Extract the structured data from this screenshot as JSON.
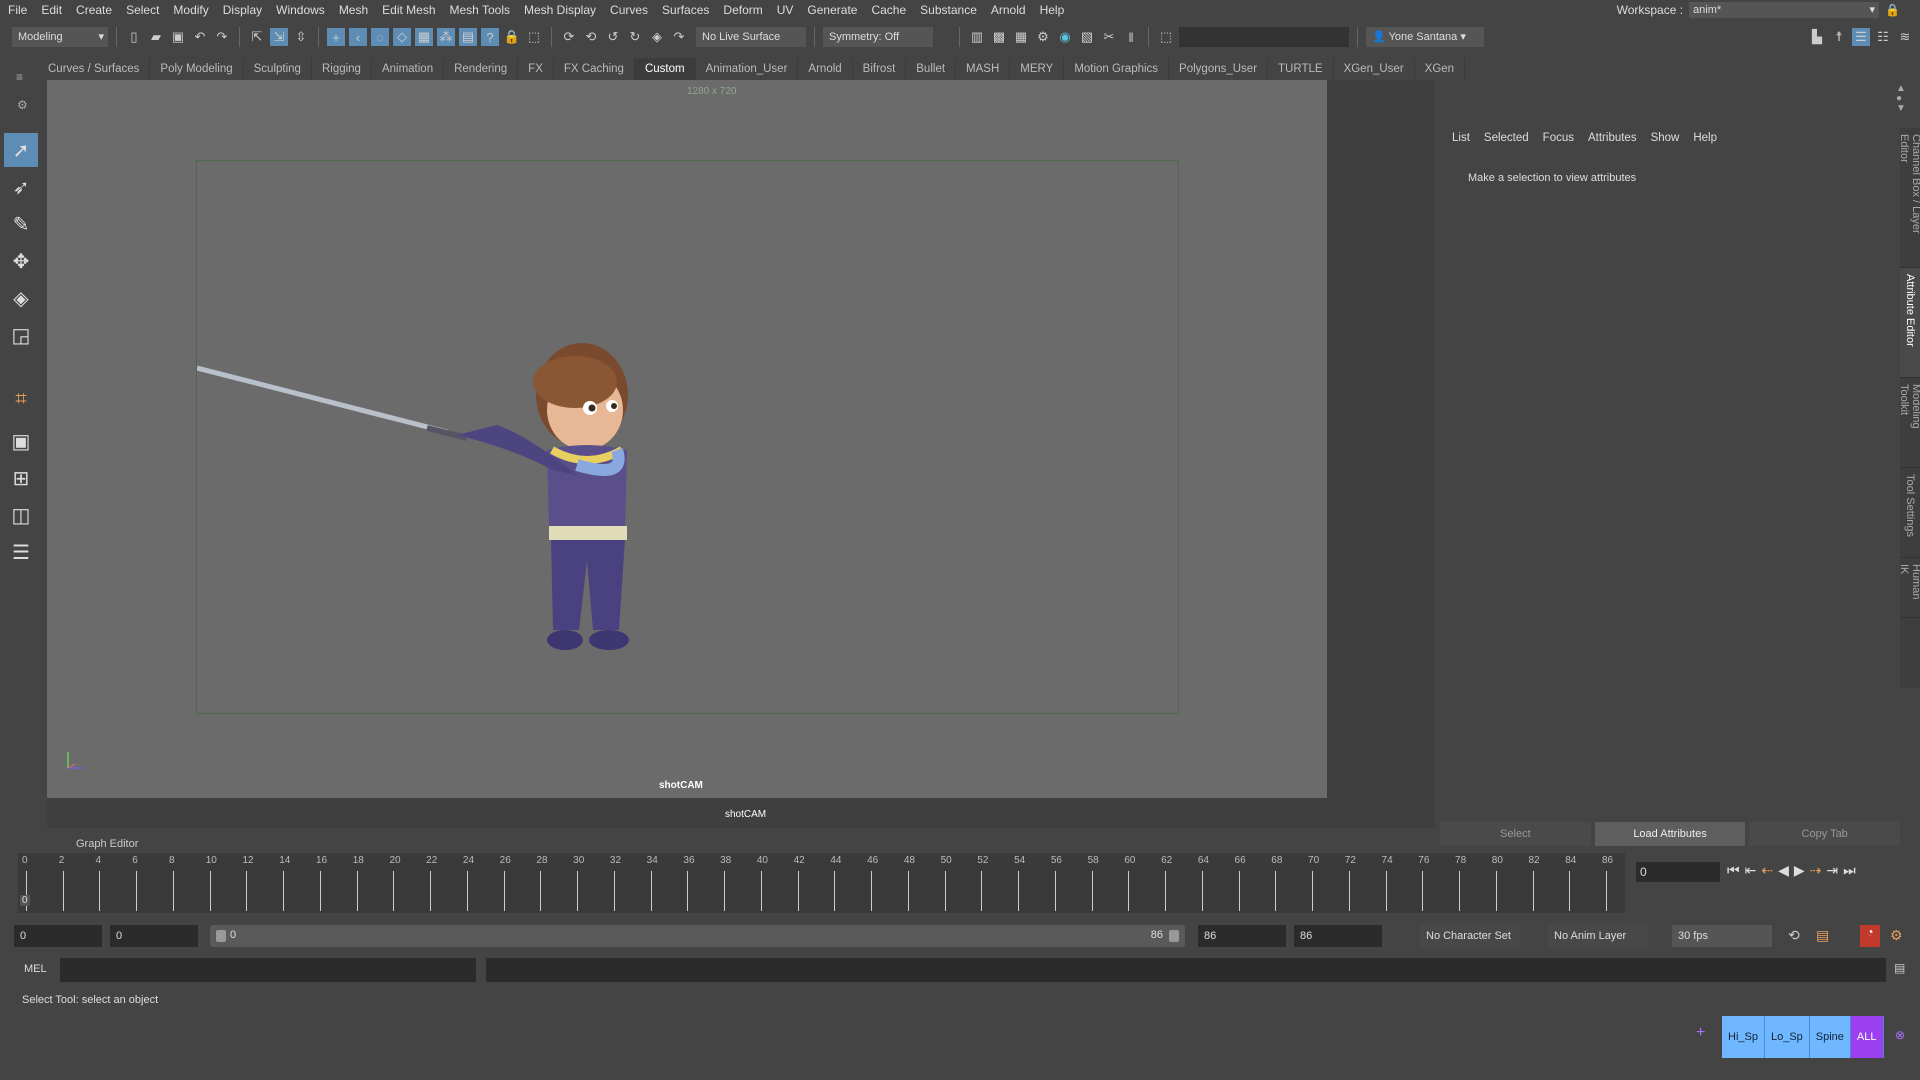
{
  "menu": [
    "File",
    "Edit",
    "Create",
    "Select",
    "Modify",
    "Display",
    "Windows",
    "Mesh",
    "Edit Mesh",
    "Mesh Tools",
    "Mesh Display",
    "Curves",
    "Surfaces",
    "Deform",
    "UV",
    "Generate",
    "Cache",
    "Substance",
    "Arnold",
    "Help"
  ],
  "workspace": {
    "label": "Workspace :",
    "value": "anim*"
  },
  "toolbar": {
    "mode": "Modeling",
    "live_surface": "No Live Surface",
    "symmetry": "Symmetry: Off",
    "user": "Yone Santana"
  },
  "shelf_tabs": [
    "Curves / Surfaces",
    "Poly Modeling",
    "Sculpting",
    "Rigging",
    "Animation",
    "Rendering",
    "FX",
    "FX Caching",
    "Custom",
    "Animation_User",
    "Arnold",
    "Bifrost",
    "Bullet",
    "MASH",
    "MERY",
    "Motion Graphics",
    "Polygons_User",
    "TURTLE",
    "XGen_User",
    "XGen"
  ],
  "active_shelf": "Custom",
  "viewport": {
    "resolution": "1280 x 720",
    "camera": "shotCAM",
    "panel_label": "shotCAM"
  },
  "attribute_editor": {
    "menu": [
      "List",
      "Selected",
      "Focus",
      "Attributes",
      "Show",
      "Help"
    ],
    "message": "Make a selection to view attributes",
    "buttons": [
      "Select",
      "Load Attributes",
      "Copy Tab"
    ]
  },
  "side_tabs": [
    "Channel Box / Layer Editor",
    "Attribute Editor",
    "Modeling Toolkit",
    "Tool Settings",
    "Human IK"
  ],
  "graph_editor_label": "Graph Editor",
  "timeline": {
    "start": 0,
    "end": 86,
    "label_step": 2,
    "current": "0",
    "current_marker": "0"
  },
  "range": {
    "start": "0",
    "anim_start": "0",
    "slider_start": "0",
    "slider_end": "86",
    "anim_end": "86",
    "end": "86",
    "character_set": "No Character Set",
    "anim_layer": "No Anim Layer",
    "fps": "30 fps"
  },
  "command_line": {
    "lang": "MEL"
  },
  "help_line": "Select Tool: select an object",
  "selection_sets": [
    "Hi_Sp",
    "Lo_Sp",
    "Spine",
    "ALL"
  ],
  "colors": {
    "accent": "#5d8db5",
    "select_set": "#6fb8ff",
    "all_set": "#9b3ff0"
  }
}
